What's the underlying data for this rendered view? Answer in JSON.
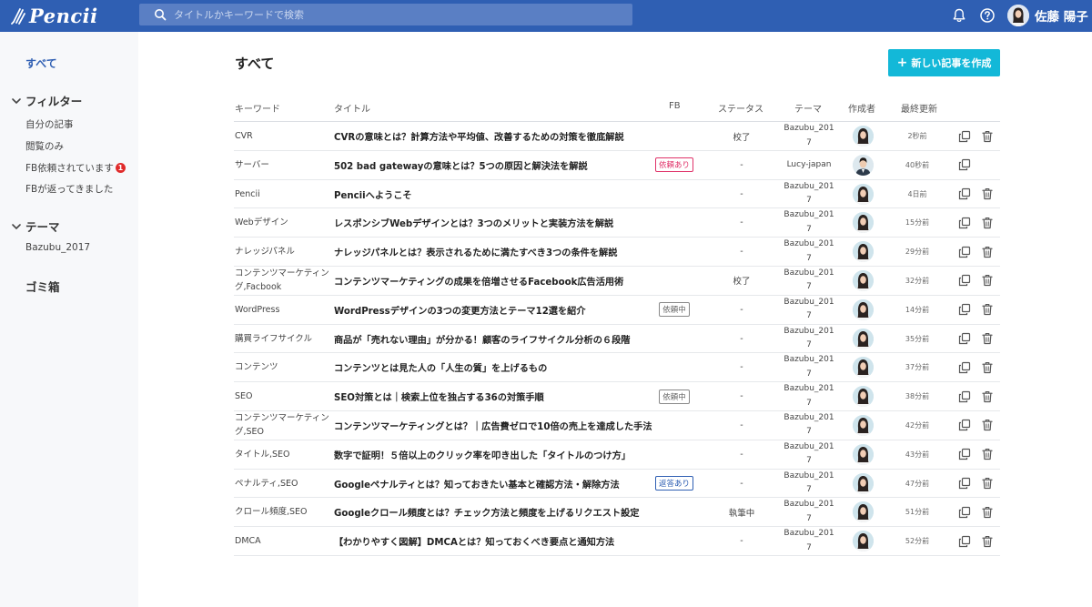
{
  "app": {
    "logo_text": "Pencii",
    "search_placeholder": "タイトルかキーワードで検索",
    "user_name": "佐藤 陽子"
  },
  "icons": {
    "logo": "pencil-logo-icon",
    "search": "search-icon",
    "bell": "bell-icon",
    "help": "question-circle-icon",
    "copy": "copy-icon",
    "trash": "trash-icon",
    "chevron": "chevron-down-icon"
  },
  "colors": {
    "header": "#2f5fb3",
    "accent": "#13b8d8",
    "active_nav": "#2f5fb3",
    "badge": "#e02a2a",
    "tag_requested": "#e0336a",
    "tag_replied": "#2f5fb3"
  },
  "sidebar": {
    "all_label": "すべて",
    "filter_label": "フィルター",
    "filter_items": [
      {
        "label": "自分の記事"
      },
      {
        "label": "閲覧のみ"
      },
      {
        "label": "FB依頼されています",
        "badge": "1"
      },
      {
        "label": "FBが返ってきました"
      }
    ],
    "theme_label": "テーマ",
    "theme_items": [
      {
        "label": "Bazubu_2017"
      }
    ],
    "trash_label": "ゴミ箱"
  },
  "main": {
    "page_title": "すべて",
    "new_button_label": "新しい記事を作成",
    "columns": {
      "keyword": "キーワード",
      "title": "タイトル",
      "fb": "FB",
      "status": "ステータス",
      "theme": "テーマ",
      "author": "作成者",
      "updated": "最終更新"
    },
    "rows": [
      {
        "keyword": "CVR",
        "title": "CVRの意味とは？計算方法や平均値、改善するための対策を徹底解説",
        "fb": "",
        "fb_style": "",
        "status": "校了",
        "theme": "Bazubu_2017",
        "author": "woman",
        "updated": "2秒前",
        "deletable": true
      },
      {
        "keyword": "サーバー",
        "title": "502 bad gatewayの意味とは？5つの原因と解決法を解説",
        "fb": "依頼あり",
        "fb_style": "red",
        "status": "-",
        "theme": "Lucy-japan",
        "author": "man",
        "updated": "40秒前",
        "deletable": false
      },
      {
        "keyword": "Pencii",
        "title": "Penciiへようこそ",
        "fb": "",
        "fb_style": "",
        "status": "-",
        "theme": "Bazubu_2017",
        "author": "woman",
        "updated": "4日前",
        "deletable": true
      },
      {
        "keyword": "Webデザイン",
        "title": "レスポンシブWebデザインとは？3つのメリットと実装方法を解説",
        "fb": "",
        "fb_style": "",
        "status": "-",
        "theme": "Bazubu_2017",
        "author": "woman",
        "updated": "15分前",
        "deletable": true
      },
      {
        "keyword": "ナレッジパネル",
        "title": "ナレッジパネルとは？表示されるために満たすべき3つの条件を解説",
        "fb": "",
        "fb_style": "",
        "status": "-",
        "theme": "Bazubu_2017",
        "author": "woman",
        "updated": "29分前",
        "deletable": true
      },
      {
        "keyword": "コンテンツマーケティング,Facbook",
        "title": "コンテンツマーケティングの成果を倍増させるFacebook広告活用術",
        "fb": "",
        "fb_style": "",
        "status": "校了",
        "theme": "Bazubu_2017",
        "author": "woman",
        "updated": "32分前",
        "deletable": true
      },
      {
        "keyword": "WordPress",
        "title": "WordPressデザインの3つの変更方法とテーマ12選を紹介",
        "fb": "依頼中",
        "fb_style": "gray",
        "status": "-",
        "theme": "Bazubu_2017",
        "author": "woman",
        "updated": "14分前",
        "deletable": true
      },
      {
        "keyword": "購買ライフサイクル",
        "title": "商品が「売れない理由」が分かる！顧客のライフサイクル分析の６段階",
        "fb": "",
        "fb_style": "",
        "status": "-",
        "theme": "Bazubu_2017",
        "author": "woman",
        "updated": "35分前",
        "deletable": true
      },
      {
        "keyword": "コンテンツ",
        "title": "コンテンツとは見た人の「人生の質」を上げるもの",
        "fb": "",
        "fb_style": "",
        "status": "-",
        "theme": "Bazubu_2017",
        "author": "woman",
        "updated": "37分前",
        "deletable": true
      },
      {
        "keyword": "SEO",
        "title": "SEO対策とは｜検索上位を独占する36の対策手順",
        "fb": "依頼中",
        "fb_style": "gray",
        "status": "-",
        "theme": "Bazubu_2017",
        "author": "woman",
        "updated": "38分前",
        "deletable": true
      },
      {
        "keyword": "コンテンツマーケティング,SEO",
        "title": "コンテンツマーケティングとは？｜広告費ゼロで10倍の売上を達成した手法",
        "fb": "",
        "fb_style": "",
        "status": "-",
        "theme": "Bazubu_2017",
        "author": "woman",
        "updated": "42分前",
        "deletable": true
      },
      {
        "keyword": "タイトル,SEO",
        "title": "数字で証明！５倍以上のクリック率を叩き出した「タイトルのつけ方」",
        "fb": "",
        "fb_style": "",
        "status": "-",
        "theme": "Bazubu_2017",
        "author": "woman",
        "updated": "43分前",
        "deletable": true
      },
      {
        "keyword": "ペナルティ,SEO",
        "title": "Googleペナルティとは？知っておきたい基本と確認方法・解除方法",
        "fb": "返答あり",
        "fb_style": "blue",
        "status": "-",
        "theme": "Bazubu_2017",
        "author": "woman",
        "updated": "47分前",
        "deletable": true
      },
      {
        "keyword": "クロール頻度,SEO",
        "title": "Googleクロール頻度とは？チェック方法と頻度を上げるリクエスト設定",
        "fb": "",
        "fb_style": "",
        "status": "執筆中",
        "theme": "Bazubu_2017",
        "author": "woman",
        "updated": "51分前",
        "deletable": true
      },
      {
        "keyword": "DMCA",
        "title": "【わかりやすく図解】DMCAとは？知っておくべき要点と通知方法",
        "fb": "",
        "fb_style": "",
        "status": "-",
        "theme": "Bazubu_2017",
        "author": "woman",
        "updated": "52分前",
        "deletable": true
      }
    ]
  }
}
